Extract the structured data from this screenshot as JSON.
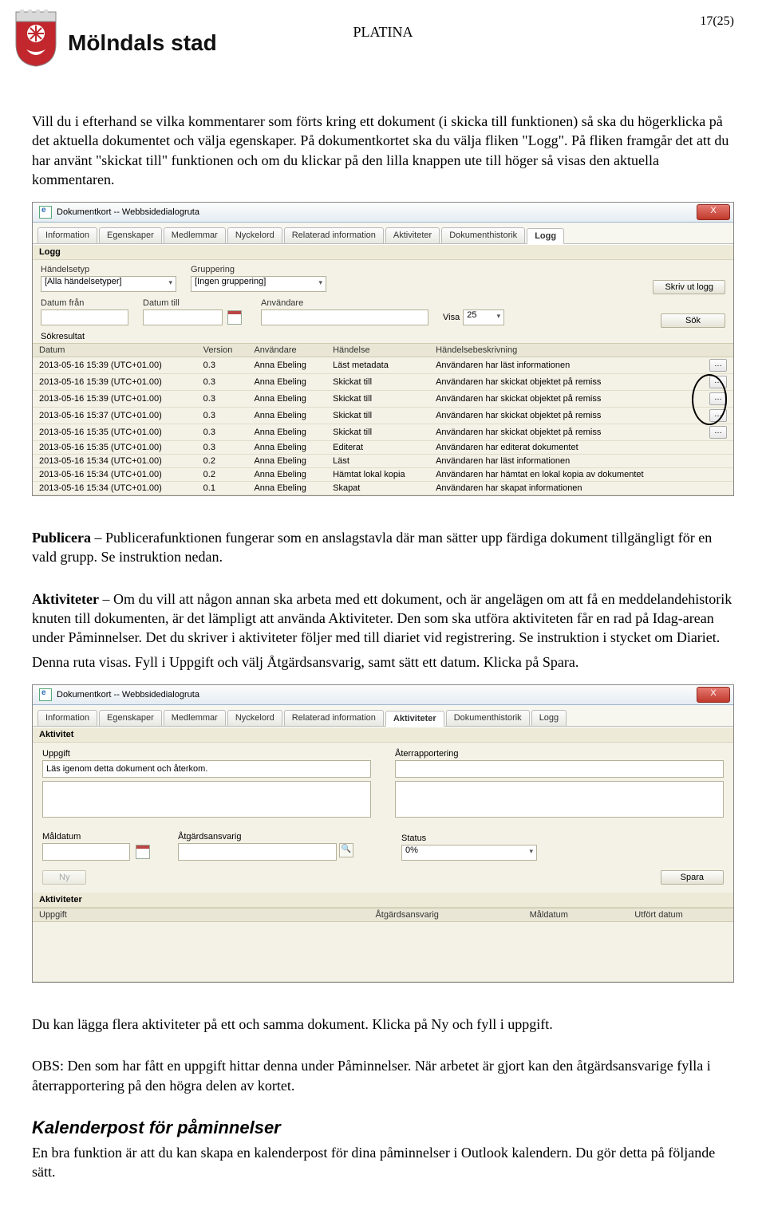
{
  "header": {
    "brand": "Mölndals stad",
    "center": "PLATINA",
    "page_counter": "17(25)"
  },
  "para1": "Vill du i efterhand se vilka kommentarer som förts kring ett dokument (i skicka till funktionen) så ska du högerklicka på det aktuella dokumentet och välja egenskaper. På dokumentkortet ska du välja fliken \"Logg\". På fliken framgår det att du har använt \"skickat till\" funktionen och om du klickar på den lilla knappen ute till höger så visas den aktuella kommentaren.",
  "sshot1": {
    "title": "Dokumentkort -- Webbsidedialogruta",
    "close": "X",
    "tabs": [
      "Information",
      "Egenskaper",
      "Medlemmar",
      "Nyckelord",
      "Relaterad information",
      "Aktiviteter",
      "Dokumenthistorik",
      "Logg"
    ],
    "active_tab": 7,
    "banner": "Logg",
    "labels": {
      "handelsetyp": "Händelsetyp",
      "gruppering": "Gruppering",
      "handelsetyp_val": "[Alla händelsetyper]",
      "gruppering_val": "[Ingen gruppering]",
      "datum_fran": "Datum från",
      "datum_till": "Datum till",
      "anvandare": "Användare",
      "visa": "Visa",
      "visa_val": "25",
      "skriv_ut": "Skriv ut logg",
      "sok": "Sök",
      "sokresultat": "Sökresultat"
    },
    "columns": [
      "Datum",
      "Version",
      "Användare",
      "Händelse",
      "Händelsebeskrivning"
    ],
    "rows": [
      [
        "2013-05-16 15:39 (UTC+01.00)",
        "0.3",
        "Anna Ebeling",
        "Läst metadata",
        "Användaren har läst informationen",
        true
      ],
      [
        "2013-05-16 15:39 (UTC+01.00)",
        "0.3",
        "Anna Ebeling",
        "Skickat till",
        "Användaren har skickat objektet på remiss",
        true
      ],
      [
        "2013-05-16 15:39 (UTC+01.00)",
        "0.3",
        "Anna Ebeling",
        "Skickat till",
        "Användaren har skickat objektet på remiss",
        true
      ],
      [
        "2013-05-16 15:37 (UTC+01.00)",
        "0.3",
        "Anna Ebeling",
        "Skickat till",
        "Användaren har skickat objektet på remiss",
        true
      ],
      [
        "2013-05-16 15:35 (UTC+01.00)",
        "0.3",
        "Anna Ebeling",
        "Skickat till",
        "Användaren har skickat objektet på remiss",
        true
      ],
      [
        "2013-05-16 15:35 (UTC+01.00)",
        "0.3",
        "Anna Ebeling",
        "Editerat",
        "Användaren har editerat dokumentet",
        false
      ],
      [
        "2013-05-16 15:34 (UTC+01.00)",
        "0.2",
        "Anna Ebeling",
        "Läst",
        "Användaren har läst informationen",
        false
      ],
      [
        "2013-05-16 15:34 (UTC+01.00)",
        "0.2",
        "Anna Ebeling",
        "Hämtat lokal kopia",
        "Användaren har hämtat en lokal kopia av dokumentet",
        false
      ],
      [
        "2013-05-16 15:34 (UTC+01.00)",
        "0.1",
        "Anna Ebeling",
        "Skapat",
        "Användaren har skapat informationen",
        false
      ]
    ]
  },
  "pub_label": "Publicera",
  "pub_text": " – Publicerafunktionen fungerar som en anslagstavla där man sätter upp färdiga dokument tillgängligt för en vald grupp. Se instruktion nedan.",
  "akt_label": "Aktiviteter",
  "akt_text": " – Om du vill att någon annan ska arbeta med ett dokument, och är angelägen om att få en meddelandehistorik knuten till dokumenten, är det lämpligt att använda Aktiviteter. Den som ska utföra aktiviteten får en rad på Idag-arean under Påminnelser. Det du skriver i aktiviteter följer med till diariet vid registrering. Se instruktion i stycket om Diariet.",
  "akt_text2": "Denna ruta visas. Fyll i Uppgift och välj Åtgärdsansvarig, samt sätt ett datum. Klicka på Spara.",
  "sshot2": {
    "title": "Dokumentkort -- Webbsidedialogruta",
    "close": "X",
    "tabs": [
      "Information",
      "Egenskaper",
      "Medlemmar",
      "Nyckelord",
      "Relaterad information",
      "Aktiviteter",
      "Dokumenthistorik",
      "Logg"
    ],
    "active_tab": 5,
    "banner": "Aktivitet",
    "labels": {
      "uppgift": "Uppgift",
      "aterrapportering": "Återrapportering",
      "uppgift_val": "Läs igenom detta dokument och återkom.",
      "maldatum": "Måldatum",
      "atgardsansvarig": "Åtgärdsansvarig",
      "status": "Status",
      "status_val": "0%",
      "ny": "Ny",
      "spara": "Spara",
      "aktiviteter": "Aktiviteter"
    },
    "columns": [
      "Uppgift",
      "Åtgärdsansvarig",
      "Måldatum",
      "Utfört datum"
    ]
  },
  "para_after": "Du kan lägga flera aktiviteter på ett och samma dokument. Klicka på Ny och fyll i uppgift.",
  "para_obs": "OBS: Den som har fått en uppgift hittar denna under Påminnelser. När arbetet är gjort kan den åtgärdsansvarige fylla i återrapportering på den högra delen av kortet.",
  "section_h": "Kalenderpost för påminnelser",
  "para_kal": "En bra funktion är att du kan skapa en kalenderpost för dina påminnelser i Outlook kalendern. Du gör detta på följande sätt."
}
